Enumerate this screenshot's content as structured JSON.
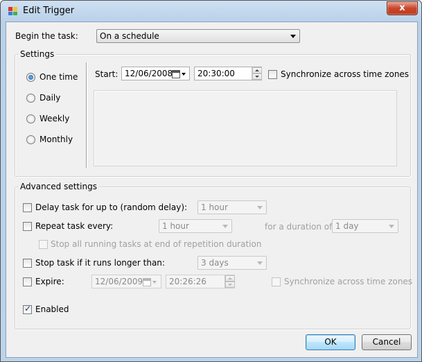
{
  "window": {
    "title": "Edit Trigger",
    "close_label": "x"
  },
  "begin_task": {
    "label": "Begin the task:",
    "value": "On a schedule"
  },
  "settings": {
    "group_title": "Settings",
    "radios": [
      {
        "label": "One time",
        "selected": true
      },
      {
        "label": "Daily",
        "selected": false
      },
      {
        "label": "Weekly",
        "selected": false
      },
      {
        "label": "Monthly",
        "selected": false
      }
    ],
    "start_label": "Start:",
    "start_date": "12/06/2008",
    "start_time": "20:30:00",
    "sync_label": "Synchronize across time zones"
  },
  "advanced": {
    "group_title": "Advanced settings",
    "delay": {
      "label": "Delay task for up to (random delay):",
      "value": "1 hour"
    },
    "repeat": {
      "label": "Repeat task every:",
      "value": "1 hour",
      "duration_label": "for a duration of:",
      "duration_value": "1 day"
    },
    "stop_running": {
      "label": "Stop all running tasks at end of repetition duration"
    },
    "stop_longer": {
      "label": "Stop task if it runs longer than:",
      "value": "3 days"
    },
    "expire": {
      "label": "Expire:",
      "date": "12/06/2009",
      "time": "20:26:26",
      "sync_label": "Synchronize across time zones"
    },
    "enabled": {
      "label": "Enabled",
      "checked": true
    }
  },
  "buttons": {
    "ok": "OK",
    "cancel": "Cancel"
  },
  "colors": {
    "title_bar": "#bcd3ea",
    "client_bg": "#f0f0f0",
    "close_red": "#c9452a",
    "default_button": "#3c7fb1"
  }
}
